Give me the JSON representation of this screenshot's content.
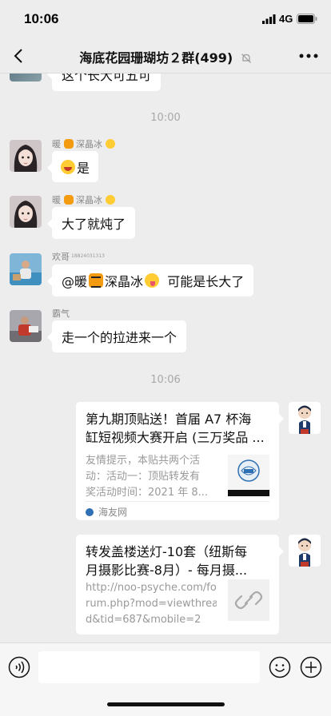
{
  "status_bar": {
    "time": "10:06",
    "network": "4G"
  },
  "header": {
    "title": "海底花园珊瑚坊２群(499)",
    "icons": {
      "back": "chevron-left-icon",
      "mute": "mute-bell-icon",
      "more": "more-dots-icon"
    }
  },
  "messages": [
    {
      "type": "text",
      "side": "left",
      "text": "这个长大可五可",
      "partial": true
    },
    {
      "type": "time",
      "text": "10:00"
    },
    {
      "type": "text",
      "side": "left",
      "sender": "暖",
      "sender_suffix": "深晶冰",
      "text": "是",
      "leading_emoji": "laughing-emoji"
    },
    {
      "type": "text",
      "side": "left",
      "sender": "暖",
      "sender_suffix": "深晶冰",
      "text": "大了就炖了"
    },
    {
      "type": "text",
      "side": "left",
      "sender": "欢哥",
      "sender_tag": "18824031313",
      "text_prefix": "@暖",
      "text_mid": " 深晶冰",
      "text_suffix": "  可能是长大了"
    },
    {
      "type": "text",
      "side": "left",
      "sender": "霸气",
      "text": "走一个的拉进来一个"
    },
    {
      "type": "time",
      "text": "10:06"
    },
    {
      "type": "link_card",
      "side": "right",
      "title": "第九期顶贴送！首届 A7 杯海\n缸短视频大赛开启 (三万奖品 ...",
      "desc": "友情提示，本贴共两个活\n动：活动一：顶贴转发有\n奖活动时间：2021 年 8...",
      "source": "海友网"
    },
    {
      "type": "link_card",
      "side": "right",
      "title": "转发盖楼送灯-10套（纽斯每\n月摄影比赛-8月）- 每月摄...",
      "desc": "http://noo-psyche.com/fo\nrum.php?mod=viewthrea\nd&tid=687&mobile=2"
    }
  ],
  "input_bar": {
    "text_value": "",
    "icons": {
      "voice": "voice-icon",
      "emoji": "emoji-icon",
      "plus": "plus-icon"
    }
  },
  "colors": {
    "background": "#ededed",
    "bubble": "#ffffff",
    "timestamp": "#a8a8a8",
    "sender_name": "#888888"
  }
}
